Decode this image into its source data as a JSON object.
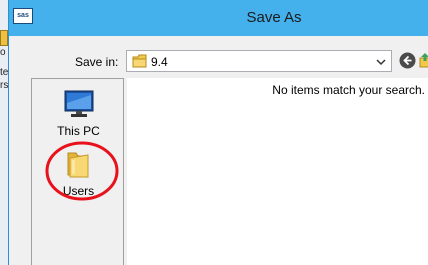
{
  "background": {
    "lines": [
      "o",
      "te",
      "rs"
    ]
  },
  "dialog": {
    "title": "Save As",
    "app_icon": "sas",
    "save_in": {
      "label": "Save in:",
      "value": "9.4"
    },
    "toolbar": {
      "back_icon": "back-arrow-icon",
      "up_icon": "up-folder-icon"
    },
    "places": [
      {
        "label": "This PC",
        "icon": "computer-icon"
      },
      {
        "label": "Users",
        "icon": "folder-icon"
      }
    ],
    "file_list": {
      "empty_message": "No items match your search."
    },
    "annotation": {
      "color": "#e8121c"
    }
  }
}
